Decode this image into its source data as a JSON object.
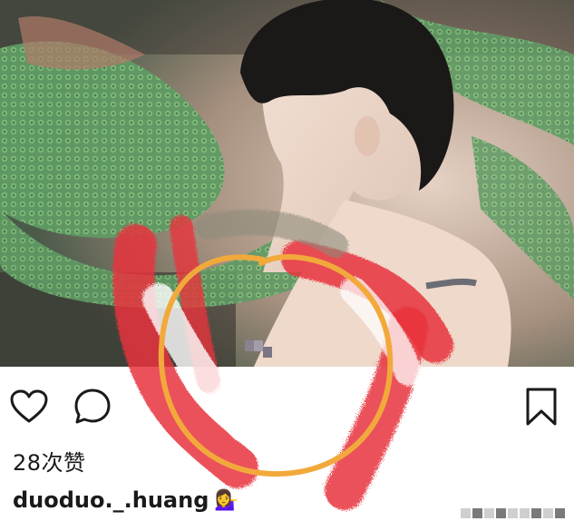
{
  "post": {
    "likes_text": "28次赞",
    "username": "duoduo._.huang",
    "emoji": "💁‍♀️"
  },
  "icons": {
    "like": "heart-icon",
    "comment": "comment-bubble-icon",
    "save": "bookmark-icon"
  },
  "colors": {
    "scribble_red": "#e8323c",
    "circle_orange": "#f2a93b",
    "text": "#1a1a1a"
  }
}
